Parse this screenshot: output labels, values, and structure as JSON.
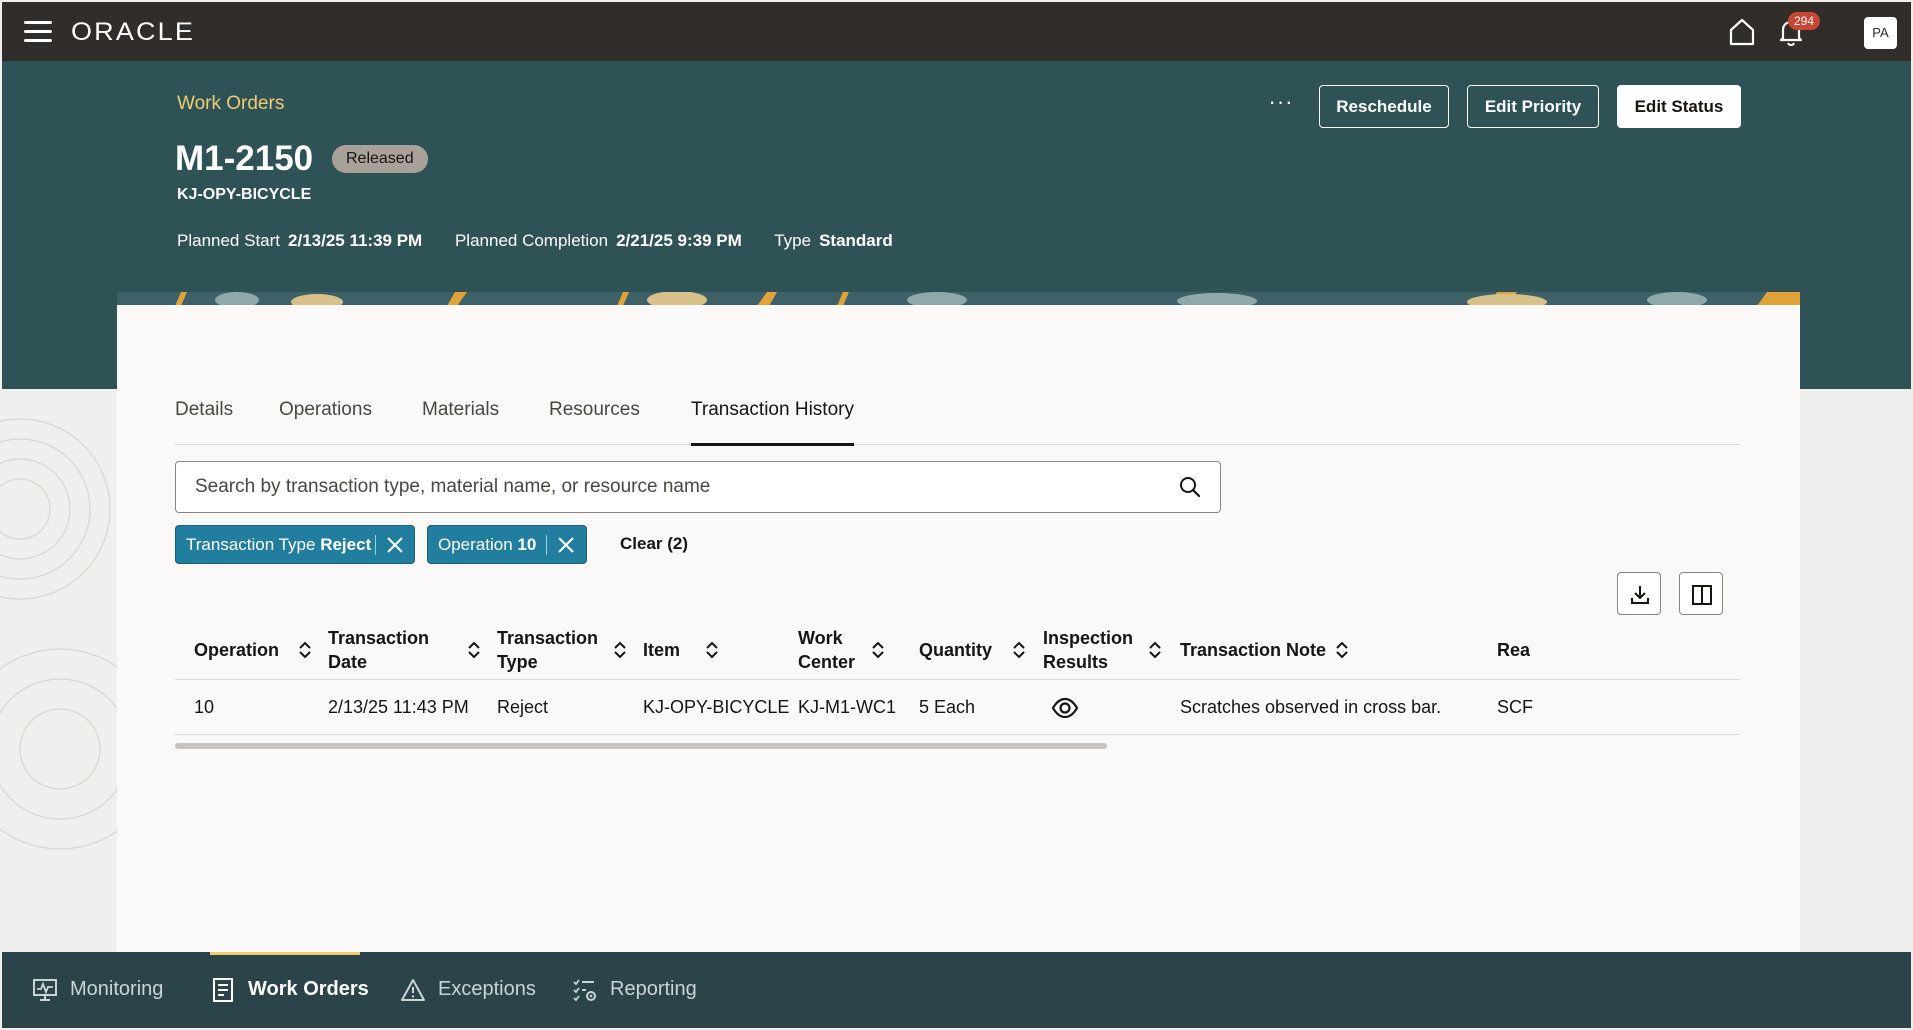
{
  "app": {
    "brand": "ORACLE",
    "notification_count": "294",
    "user_initials": "PA"
  },
  "header": {
    "breadcrumb": "Work Orders",
    "work_order_number": "M1-2150",
    "status": "Released",
    "item": "KJ-OPY-BICYCLE",
    "meta": {
      "planned_start_label": "Planned Start",
      "planned_start_value": "2/13/25 11:39 PM",
      "planned_completion_label": "Planned Completion",
      "planned_completion_value": "2/21/25 9:39 PM",
      "type_label": "Type",
      "type_value": "Standard"
    },
    "actions": {
      "more": "···",
      "reschedule": "Reschedule",
      "edit_priority": "Edit Priority",
      "edit_status": "Edit Status"
    }
  },
  "tabs": [
    {
      "label": "Details"
    },
    {
      "label": "Operations"
    },
    {
      "label": "Materials"
    },
    {
      "label": "Resources"
    },
    {
      "label": "Transaction History",
      "active": true
    }
  ],
  "search": {
    "placeholder": "Search by transaction type, material name, or resource name",
    "value": ""
  },
  "filters": {
    "chips": [
      {
        "label": "Transaction Type",
        "value": "Reject"
      },
      {
        "label": "Operation",
        "value": "10"
      }
    ],
    "clear_label": "Clear (2)"
  },
  "table": {
    "columns": [
      {
        "label": "Operation"
      },
      {
        "label": "Transaction Date"
      },
      {
        "label": "Transaction Type"
      },
      {
        "label": "Item"
      },
      {
        "label": "Work Center"
      },
      {
        "label": "Quantity"
      },
      {
        "label": "Inspection Results"
      },
      {
        "label": "Transaction Note"
      },
      {
        "label": "Rea"
      }
    ],
    "rows": [
      {
        "operation": "10",
        "transaction_date": "2/13/25 11:43 PM",
        "transaction_type": "Reject",
        "item": "KJ-OPY-BICYCLE",
        "work_center": "KJ-M1-WC1",
        "quantity": "5 Each",
        "inspection_results_icon": "eye-icon",
        "transaction_note": "Scratches observed in cross bar.",
        "reason": "SCF"
      }
    ]
  },
  "bottom_nav": {
    "items": [
      {
        "label": "Monitoring",
        "icon": "monitor-chart-icon"
      },
      {
        "label": "Work Orders",
        "icon": "document-icon",
        "active": true
      },
      {
        "label": "Exceptions",
        "icon": "warning-triangle-icon"
      },
      {
        "label": "Reporting",
        "icon": "checklist-gear-icon"
      }
    ]
  },
  "colors": {
    "top_bar": "#312d2a",
    "header_teal": "#2f5257",
    "breadcrumb_gold": "#f0cc71",
    "chip_blue": "#227e9e",
    "notification_red": "#c74634",
    "bottom_nav": "#2a4449"
  }
}
